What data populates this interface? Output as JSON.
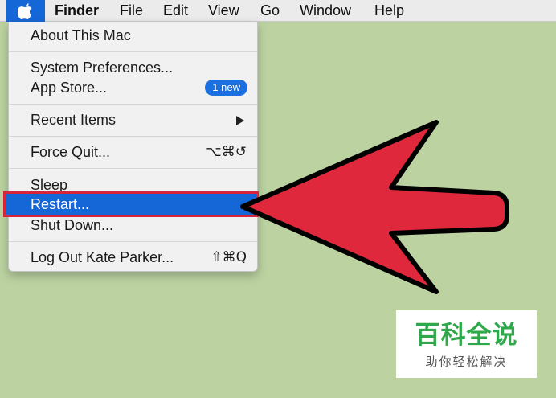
{
  "menubar": {
    "apple_icon": "apple-logo-icon",
    "items": [
      {
        "label": "Finder",
        "bold": true
      },
      {
        "label": "File"
      },
      {
        "label": "Edit"
      },
      {
        "label": "View"
      },
      {
        "label": "Go"
      },
      {
        "label": "Window"
      },
      {
        "label": "Help"
      }
    ]
  },
  "apple_menu": {
    "about": "About This Mac",
    "system_preferences": "System Preferences...",
    "app_store": "App Store...",
    "app_store_badge": "1 new",
    "recent_items": "Recent Items",
    "recent_items_icon": "submenu-arrow-icon",
    "force_quit": "Force Quit...",
    "force_quit_shortcut": "⌥⌘↺",
    "sleep": "Sleep",
    "restart": "Restart...",
    "shut_down": "Shut Down...",
    "log_out": "Log Out Kate Parker...",
    "log_out_shortcut": "⇧⌘Q",
    "highlighted_item": "Restart..."
  },
  "annotation": {
    "arrow_icon": "red-arrow-icon",
    "arrow_color": "#e0283d",
    "highlight_border_color": "#d6253b"
  },
  "colors": {
    "desktop": "#bcd3a1",
    "selection_blue": "#1567d8",
    "badge_blue": "#1b6fe0"
  },
  "watermark": {
    "logo_text": "百科全说",
    "sub_text": "助你轻松解决"
  }
}
